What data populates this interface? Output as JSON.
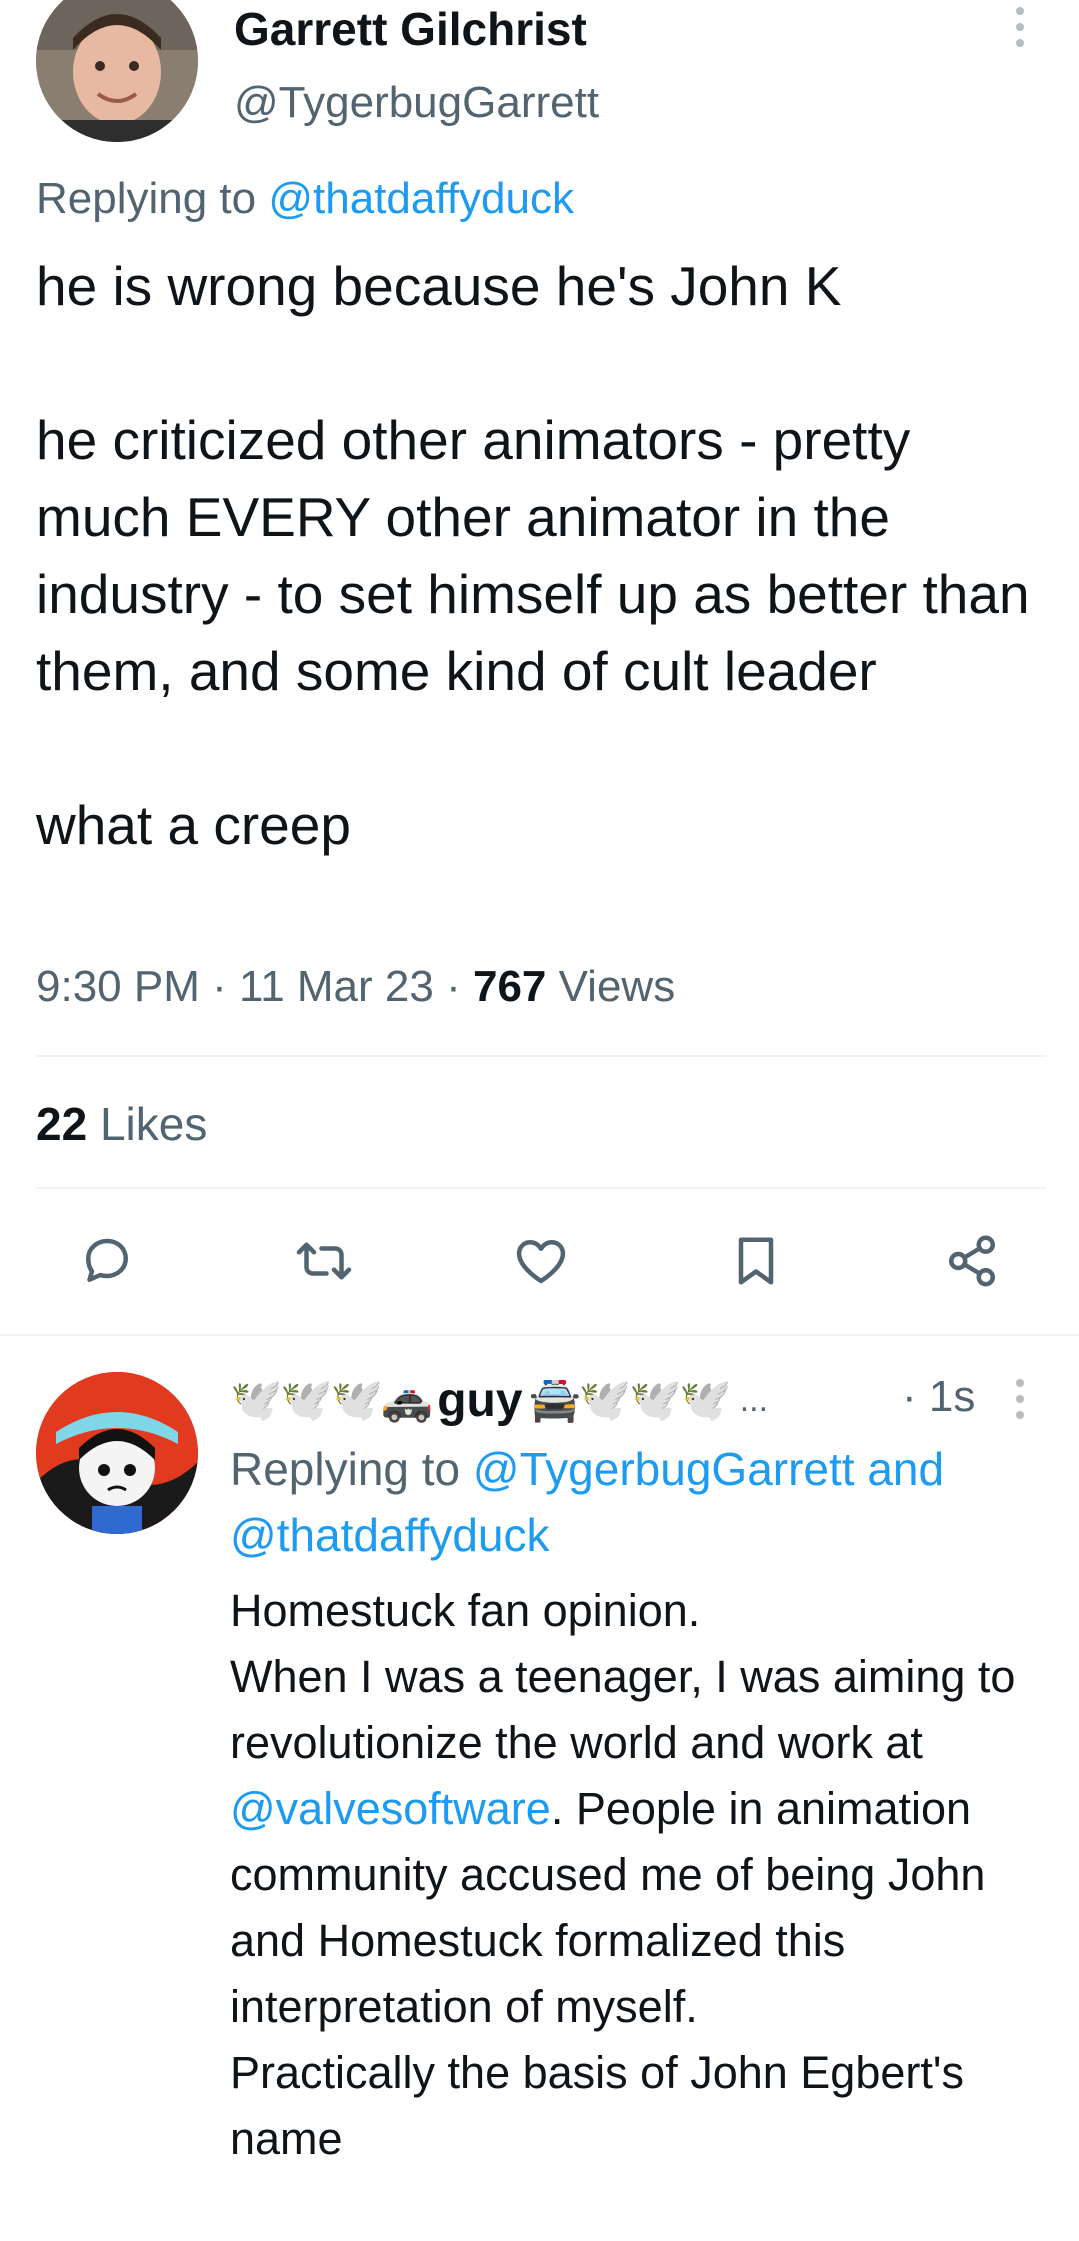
{
  "tweet": {
    "display_name": "Garrett Gilchrist",
    "handle": "@TygerbugGarrett",
    "replying_prefix": "Replying to",
    "replying_to": "@thatdaffyduck",
    "paragraphs": [
      "he is wrong because he's John K",
      "he criticized other animators - pretty much EVERY other animator in the industry - to set himself up as better than them, and some kind of cult leader",
      "what a creep"
    ],
    "time": "9:30 PM",
    "date": "11 Mar 23",
    "separator": "·",
    "views_count": "767",
    "views_label": "Views",
    "likes_count": "22",
    "likes_label": "Likes"
  },
  "actions": [
    {
      "icon": "reply-icon"
    },
    {
      "icon": "retweet-icon"
    },
    {
      "icon": "like-icon"
    },
    {
      "icon": "bookmark-icon"
    },
    {
      "icon": "share-icon"
    }
  ],
  "reply": {
    "emoji_left": "🕊️🕊️🕊️🚓",
    "name": "guy",
    "emoji_right": "🚔🕊️🕊️🕊️",
    "ellipsis": "...",
    "time": "· 1s",
    "replying_prefix": "Replying to",
    "replying_to_1": "@TygerbugGarrett",
    "replying_and": "and",
    "replying_to_2": "@thatdaffyduck",
    "lines": {
      "l1": "Homestuck fan opinion.",
      "l2": "When I was a teenager, I was aiming to revolutionize the world and work at",
      "mention": "@valvesoftware",
      "l2_rest": ". People in animation community accused me of being John and Homestuck formalized this interpretation of myself.",
      "l3": "Practically the basis of John Egbert's name"
    }
  },
  "colors": {
    "link": "#1d9bf0",
    "muted": "#536471",
    "text": "#0f1419",
    "divider": "#eff3f4"
  }
}
